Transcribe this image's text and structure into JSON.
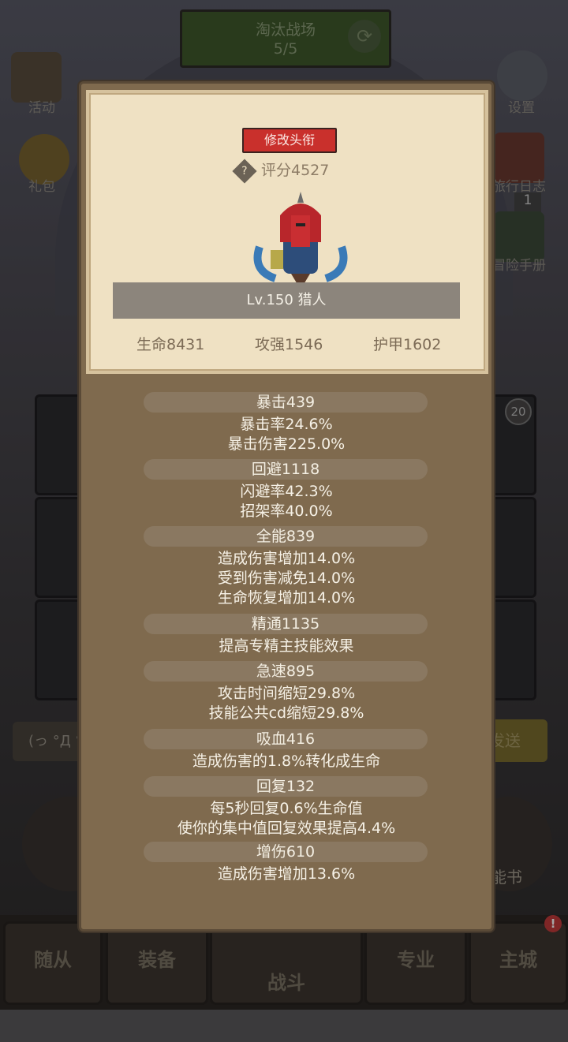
{
  "background": {
    "top_banner": {
      "title": "淘汰战场",
      "progress": "5/5"
    },
    "left_menu": [
      {
        "label": "活动"
      },
      {
        "label": "礼包"
      }
    ],
    "right_menu": [
      {
        "label": "设置"
      },
      {
        "label": "旅行日志",
        "badge": "1"
      },
      {
        "label": "冒险手册"
      }
    ],
    "slot_badge": "20",
    "chat_text": "(っ °Д °",
    "send_label": "发送",
    "skill_book_label": "能书",
    "bottom_nav": [
      {
        "label": "随从"
      },
      {
        "label": "装备"
      },
      {
        "label": "战斗"
      },
      {
        "label": "专业"
      },
      {
        "label": "主城"
      }
    ],
    "notice_badge": "!"
  },
  "profile": {
    "change_title_button": "修改头衔",
    "score_label": "评分4527",
    "help_icon": "?",
    "level_name": "Lv.150 猎人",
    "stats": {
      "hp": "生命8431",
      "attack": "攻强1546",
      "armor": "护甲1602"
    }
  },
  "attributes": [
    {
      "header": "暴击439",
      "lines": [
        "暴击率24.6%",
        "暴击伤害225.0%"
      ]
    },
    {
      "header": "回避1118",
      "lines": [
        "闪避率42.3%",
        "招架率40.0%"
      ]
    },
    {
      "header": "全能839",
      "lines": [
        "造成伤害增加14.0%",
        "受到伤害减免14.0%",
        "生命恢复增加14.0%"
      ]
    },
    {
      "header": "精通1135",
      "lines": [
        "提高专精主技能效果"
      ]
    },
    {
      "header": "急速895",
      "lines": [
        "攻击时间缩短29.8%",
        "技能公共cd缩短29.8%"
      ]
    },
    {
      "header": "吸血416",
      "lines": [
        "造成伤害的1.8%转化成生命"
      ]
    },
    {
      "header": "回复132",
      "lines": [
        "每5秒回复0.6%生命值",
        "使你的集中值回复效果提高4.4%"
      ]
    },
    {
      "header": "增伤610",
      "lines": [
        "造成伤害增加13.6%"
      ]
    }
  ],
  "colors": {
    "button_red": "#c9302c",
    "panel_brown": "#7f6a4e",
    "card_cream": "#efe1c3"
  }
}
